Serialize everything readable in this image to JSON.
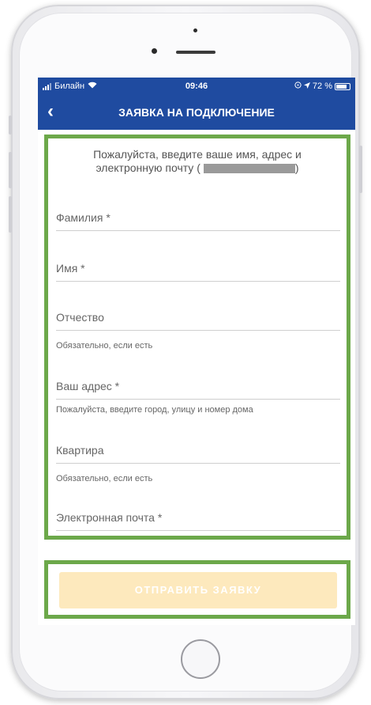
{
  "status_bar": {
    "carrier": "Билайн",
    "time": "09:46",
    "battery": "72 %"
  },
  "nav": {
    "title": "ЗАЯВКА НА ПОДКЛЮЧЕНИЕ"
  },
  "form": {
    "intro_line1": "Пожалуйста, введите ваше имя, адрес и",
    "intro_line2": "электронную почту (",
    "intro_end": ")",
    "fields": [
      {
        "label": "Фамилия *"
      },
      {
        "label": "Имя *"
      },
      {
        "label": "Отчество",
        "hint": "Обязательно, если есть"
      },
      {
        "label": "Ваш адрес *",
        "hint": "Пожалуйста, введите город, улицу и номер дома"
      },
      {
        "label": "Квартира",
        "hint": "Обязательно, если есть"
      },
      {
        "label": "Электронная почта *"
      }
    ]
  },
  "submit_label": "ОТПРАВИТЬ ЗАЯВКУ",
  "colors": {
    "nav_bg": "#1f4ba0",
    "highlight": "#6ca84a",
    "button_bg": "#fde9bd"
  }
}
